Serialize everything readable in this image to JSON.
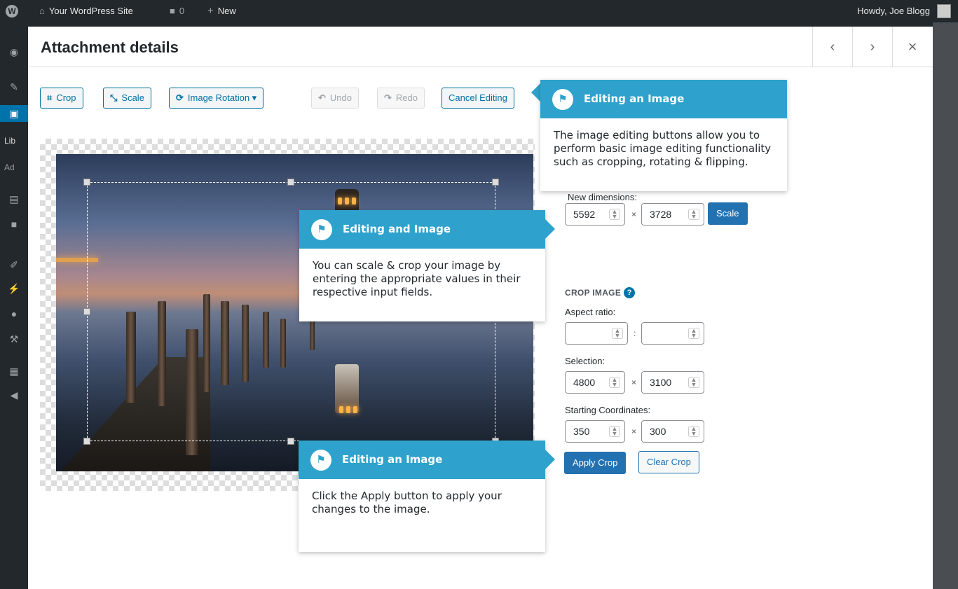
{
  "admin_bar": {
    "wp_logo": "W",
    "site_icon": "home-icon",
    "site_name": "Your WordPress Site",
    "comments_icon": "comment-icon",
    "comments_count": "0",
    "new_icon": "plus-icon",
    "new_label": "New",
    "howdy": "Howdy, Joe Blogg"
  },
  "admin_menu": {
    "items": [
      "dashboard-icon",
      "pin-icon",
      "media-icon",
      "pages-icon",
      "comments-icon",
      "appearance-icon",
      "plugins-icon",
      "users-icon",
      "tools-icon",
      "settings-icon",
      "collapse-icon"
    ],
    "submenu_library": "Lib",
    "submenu_add": "Ad"
  },
  "modal": {
    "title": "Attachment details",
    "prev_icon": "‹",
    "next_icon": "›",
    "close_icon": "×"
  },
  "toolbar": {
    "crop_icon": "⌗",
    "crop": "Crop",
    "scale_icon": "⤡",
    "scale": "Scale",
    "rotation_icon": "⟳",
    "rotation": "Image Rotation ▾",
    "undo_icon": "↶",
    "undo": "Undo",
    "redo_icon": "↷",
    "redo": "Redo",
    "cancel": "Cancel Editing"
  },
  "scale_panel": {
    "new_dimensions_label": "New dimensions:",
    "width": "5592",
    "height": "3728",
    "times": "×",
    "scale_button": "Scale"
  },
  "crop_panel": {
    "title": "CROP IMAGE",
    "help": "?",
    "aspect_ratio_label": "Aspect ratio:",
    "aspect_w": "",
    "aspect_h": "",
    "colon": ":",
    "selection_label": "Selection:",
    "selection_w": "4800",
    "selection_h": "3100",
    "starting_coords_label": "Starting Coordinates:",
    "start_x": "350",
    "start_y": "300",
    "apply_button": "Apply Crop",
    "clear_button": "Clear Crop"
  },
  "pointers": [
    {
      "title": "Editing an Image",
      "body": "The image editing buttons allow you to perform basic image editing functionality such as cropping, rotating & flipping."
    },
    {
      "title": "Editing and Image",
      "body": "You can scale & crop your image by entering the appropriate values in their respective input fields."
    },
    {
      "title": "Editing an Image",
      "body": "Click the Apply button to apply your changes to the image."
    }
  ],
  "colors": {
    "accent": "#2271b1",
    "pointer_header": "#2ea2cc",
    "admin_bar": "#23282d"
  }
}
